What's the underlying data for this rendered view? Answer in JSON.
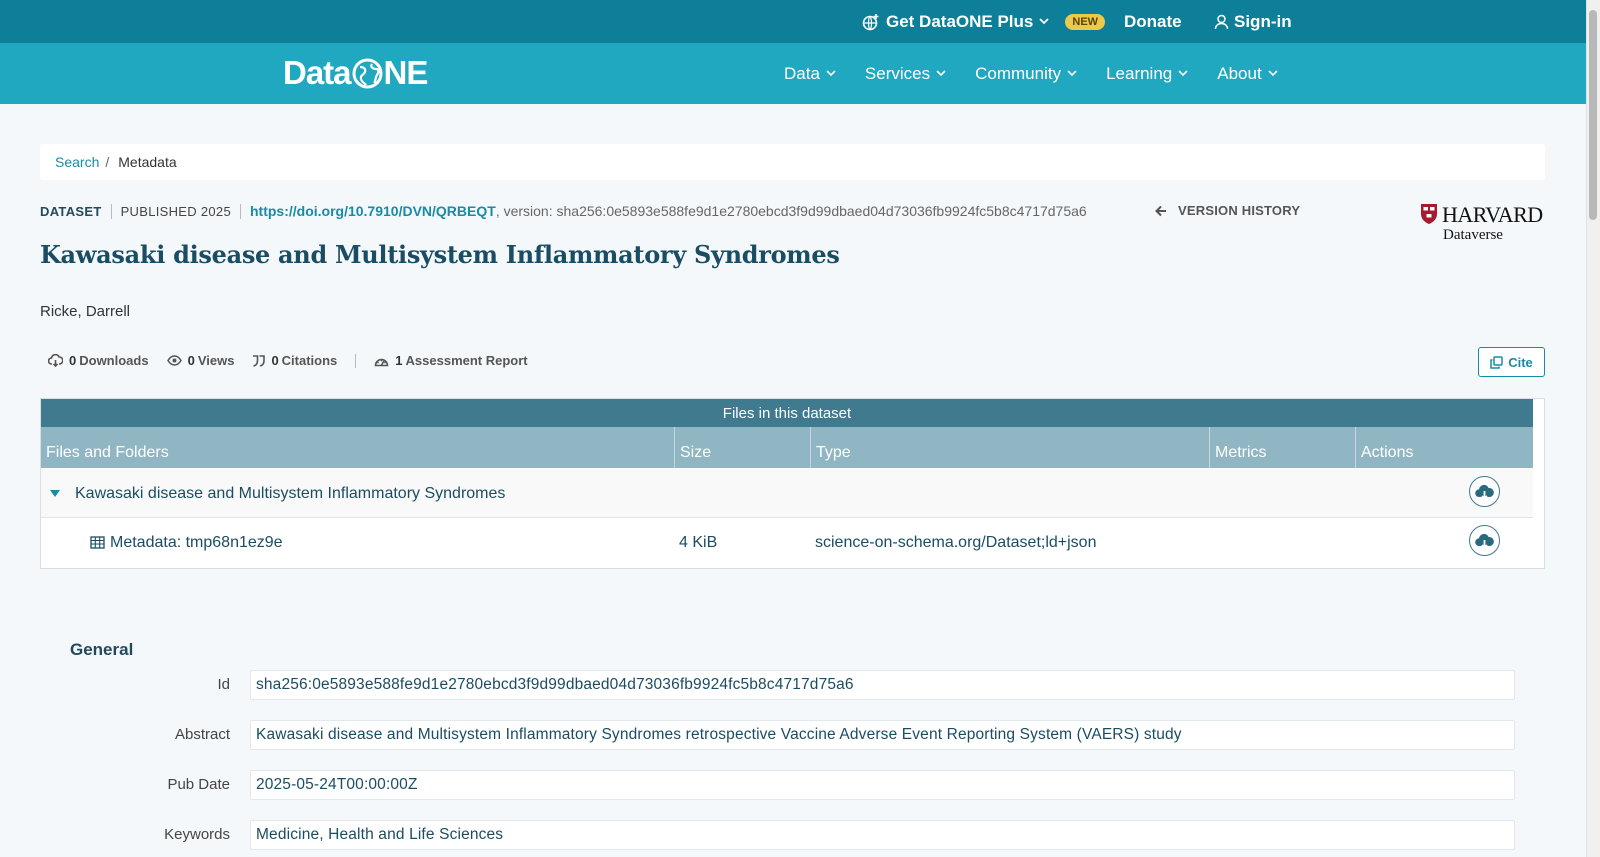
{
  "topbar": {
    "plus_label": "Get DataONE Plus",
    "new_badge": "NEW",
    "donate_label": "Donate",
    "signin_label": "Sign-in"
  },
  "nav": {
    "logo_left": "Data",
    "logo_right": "NE",
    "items": [
      {
        "label": "Data"
      },
      {
        "label": "Services"
      },
      {
        "label": "Community"
      },
      {
        "label": "Learning"
      },
      {
        "label": "About"
      }
    ]
  },
  "breadcrumb": {
    "search": "Search",
    "separator": "/",
    "current": "Metadata"
  },
  "dataset": {
    "type": "DATASET",
    "published": "PUBLISHED 2025",
    "doi": "https://doi.org/10.7910/DVN/QRBEQT",
    "version": ", version: sha256:0e5893e588fe9d1e2780ebcd3f9d99dbaed04d73036fb9924fc5b8c4717d75a6",
    "version_history": "VERSION HISTORY",
    "repository_line1": "HARVARD",
    "repository_line2": "Dataverse",
    "title": "Kawasaki disease and Multisystem Inflammatory Syndromes",
    "author": "Ricke, Darrell"
  },
  "stats": {
    "downloads_count": "0",
    "downloads_label": "Downloads",
    "views_count": "0",
    "views_label": "Views",
    "citations_count": "0",
    "citations_label": "Citations",
    "assessment_count": "1",
    "assessment_label": "Assessment Report",
    "cite_label": "Cite"
  },
  "files": {
    "caption": "Files in this dataset",
    "columns": [
      "Files and Folders",
      "Size",
      "Type",
      "Metrics",
      "Actions"
    ],
    "folder": {
      "name": "Kawasaki disease and Multisystem Inflammatory Syndromes"
    },
    "file": {
      "name": "Metadata: tmp68n1ez9e",
      "size": "4 KiB",
      "type": "science-on-schema.org/Dataset;ld+json"
    }
  },
  "general": {
    "heading": "General",
    "fields": [
      {
        "label": "Id",
        "value": "sha256:0e5893e588fe9d1e2780ebcd3f9d99dbaed04d73036fb9924fc5b8c4717d75a6"
      },
      {
        "label": "Abstract",
        "value": "Kawasaki disease and Multisystem Inflammatory Syndromes retrospective Vaccine Adverse Event Reporting System (VAERS) study"
      },
      {
        "label": "Pub Date",
        "value": "2025-05-24T00:00:00Z"
      },
      {
        "label": "Keywords",
        "value": "Medicine, Health and Life Sciences"
      }
    ]
  },
  "colors": {
    "topbar": "#0d7f99",
    "nav": "#1fa8c0",
    "accent": "#1a8ba5",
    "table_caption": "#3f7a8f",
    "table_header": "#90b5c3",
    "badge": "#ecc94b"
  }
}
